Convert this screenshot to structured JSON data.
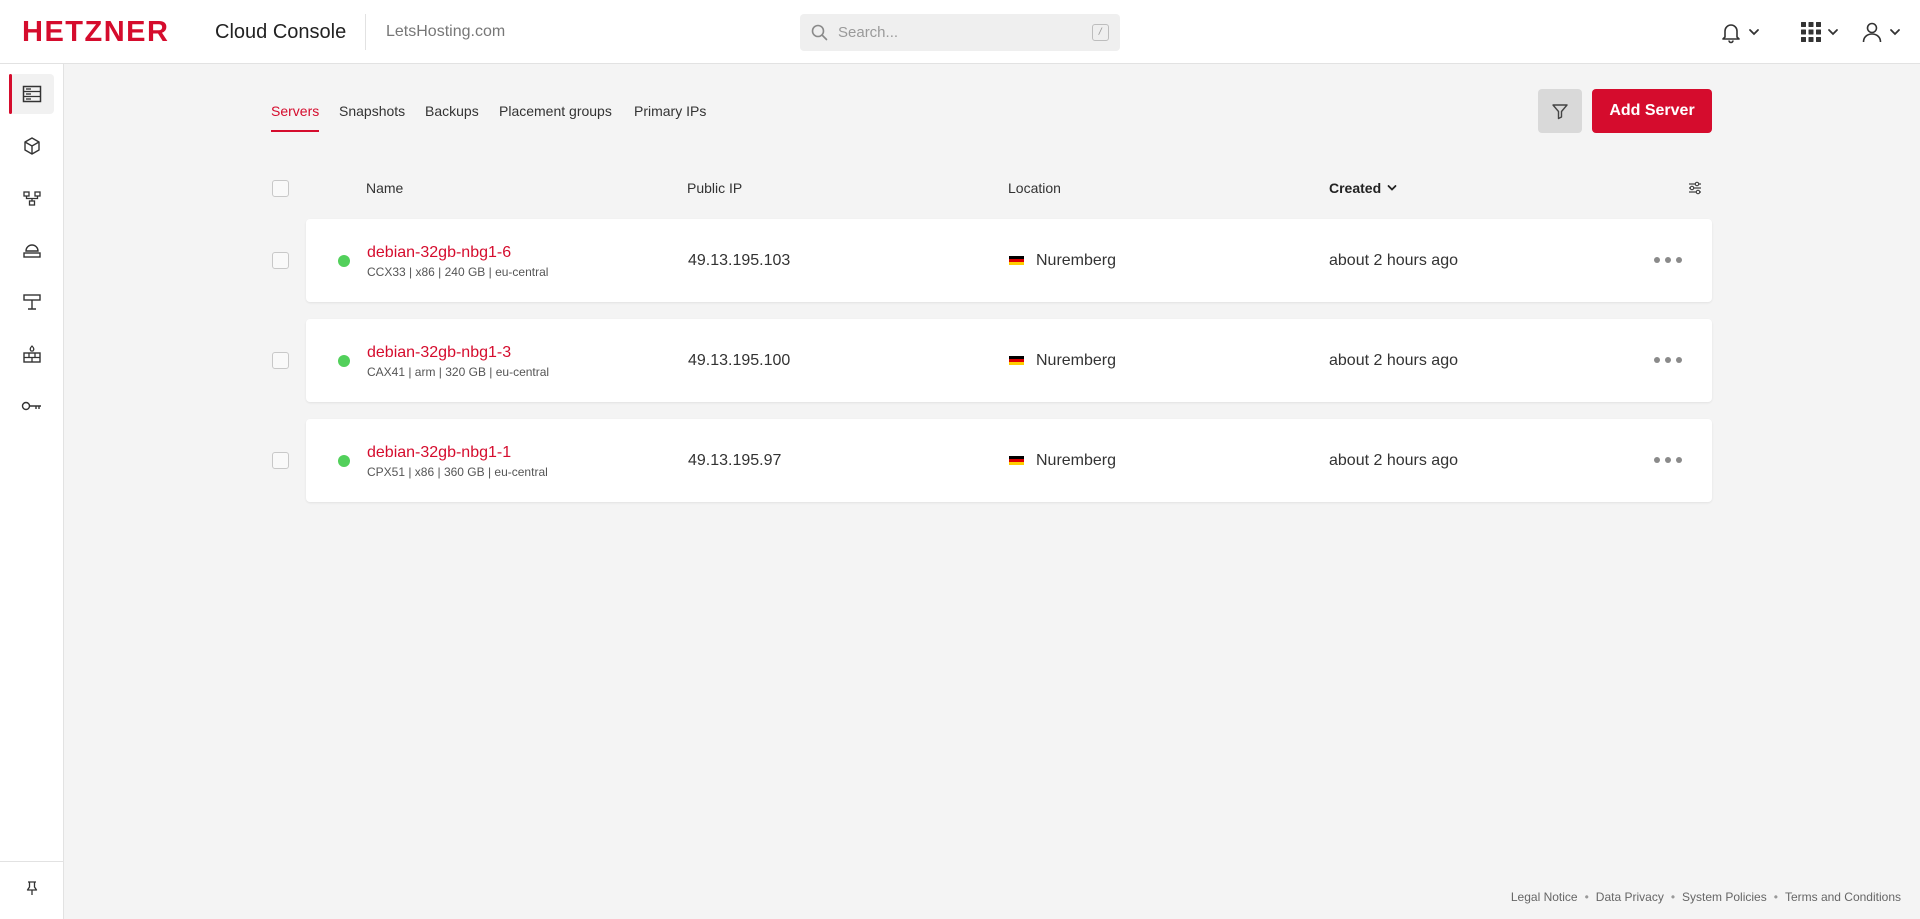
{
  "header": {
    "logo_text": "HETZNER",
    "app_title": "Cloud Console",
    "project": "LetsHosting.com",
    "search": {
      "placeholder": "Search...",
      "shortcut": "/"
    },
    "icons": [
      "bell-icon",
      "apps-grid-icon",
      "user-icon"
    ]
  },
  "sidebar": {
    "items": [
      {
        "name": "servers",
        "icon": "server-list-icon",
        "active": true
      },
      {
        "name": "volumes",
        "icon": "box-icon",
        "active": false
      },
      {
        "name": "networks",
        "icon": "network-icon",
        "active": false
      },
      {
        "name": "load-balancers",
        "icon": "load-balancer-icon",
        "active": false
      },
      {
        "name": "floating-ips",
        "icon": "ip-icon",
        "active": false
      },
      {
        "name": "firewalls",
        "icon": "firewall-icon",
        "active": false
      },
      {
        "name": "ssh-keys",
        "icon": "key-icon",
        "active": false
      }
    ],
    "pin_icon": "pin-icon"
  },
  "tabs": [
    {
      "label": "Servers",
      "active": true
    },
    {
      "label": "Snapshots",
      "active": false
    },
    {
      "label": "Backups",
      "active": false
    },
    {
      "label": "Placement groups",
      "active": false
    },
    {
      "label": "Primary IPs",
      "active": false
    }
  ],
  "actions": {
    "filter_icon": "filter-icon",
    "add_server_label": "Add Server"
  },
  "table": {
    "columns": {
      "name": "Name",
      "public_ip": "Public IP",
      "location": "Location",
      "created": "Created"
    },
    "rows": [
      {
        "name": "debian-32gb-nbg1-6",
        "meta": "CCX33 | x86 | 240 GB | eu-central",
        "ip": "49.13.195.103",
        "location": "Nuremberg",
        "created": "about 2 hours ago",
        "status": "running"
      },
      {
        "name": "debian-32gb-nbg1-3",
        "meta": "CAX41 | arm | 320 GB | eu-central",
        "ip": "49.13.195.100",
        "location": "Nuremberg",
        "created": "about 2 hours ago",
        "status": "running"
      },
      {
        "name": "debian-32gb-nbg1-1",
        "meta": "CPX51 | x86 | 360 GB | eu-central",
        "ip": "49.13.195.97",
        "location": "Nuremberg",
        "created": "about 2 hours ago",
        "status": "running"
      }
    ]
  },
  "footer": {
    "links": [
      "Legal Notice",
      "Data Privacy",
      "System Policies",
      "Terms and Conditions"
    ]
  },
  "colors": {
    "brand": "#d50c2d",
    "status_running": "#52d05b"
  }
}
